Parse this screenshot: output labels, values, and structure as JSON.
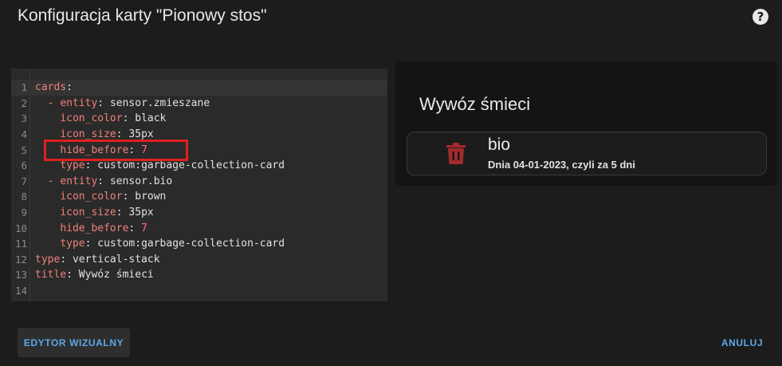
{
  "dialog": {
    "title": "Konfiguracja karty \"Pionowy stos\"",
    "help_icon": "question-mark-circle-icon"
  },
  "editor": {
    "lines": [
      {
        "n": "1",
        "key": "cards",
        "sep": ":",
        "value": "",
        "indent": "",
        "number": false
      },
      {
        "n": "2",
        "key": "entity",
        "sep": ": ",
        "value": "sensor.zmieszane",
        "indent": "  - ",
        "number": false
      },
      {
        "n": "3",
        "key": "icon_color",
        "sep": ": ",
        "value": "black",
        "indent": "    ",
        "number": false
      },
      {
        "n": "4",
        "key": "icon_size",
        "sep": ": ",
        "value": "35px",
        "indent": "    ",
        "number": false
      },
      {
        "n": "5",
        "key": "hide_before",
        "sep": ": ",
        "value": "7",
        "indent": "    ",
        "number": true
      },
      {
        "n": "6",
        "key": "type",
        "sep": ": ",
        "value": "custom:garbage-collection-card",
        "indent": "    ",
        "number": false
      },
      {
        "n": "7",
        "key": "entity",
        "sep": ": ",
        "value": "sensor.bio",
        "indent": "  - ",
        "number": false
      },
      {
        "n": "8",
        "key": "icon_color",
        "sep": ": ",
        "value": "brown",
        "indent": "    ",
        "number": false
      },
      {
        "n": "9",
        "key": "icon_size",
        "sep": ": ",
        "value": "35px",
        "indent": "    ",
        "number": false
      },
      {
        "n": "10",
        "key": "hide_before",
        "sep": ": ",
        "value": "7",
        "indent": "    ",
        "number": true
      },
      {
        "n": "11",
        "key": "type",
        "sep": ": ",
        "value": "custom:garbage-collection-card",
        "indent": "    ",
        "number": false
      },
      {
        "n": "12",
        "key": "type",
        "sep": ": ",
        "value": "vertical-stack",
        "indent": "",
        "number": false
      },
      {
        "n": "13",
        "key": "title",
        "sep": ": ",
        "value": "Wywóz śmieci",
        "indent": "",
        "number": false
      },
      {
        "n": "14",
        "key": "",
        "sep": "",
        "value": "",
        "indent": "",
        "number": false
      }
    ],
    "active_line": 1,
    "highlight_color": "#e02020"
  },
  "preview": {
    "title": "Wywóz śmieci",
    "entity": {
      "icon": "trash-can-icon",
      "icon_color": "#a52a2a",
      "name": "bio",
      "detail": "Dnia 04-01-2023, czyli za 5 dni"
    }
  },
  "buttons": {
    "visual_editor": "EDYTOR WIZUALNY",
    "cancel": "ANULUJ"
  },
  "colors": {
    "accent": "#5aa8e8",
    "key": "#f0817a",
    "number": "#ff6b81"
  }
}
